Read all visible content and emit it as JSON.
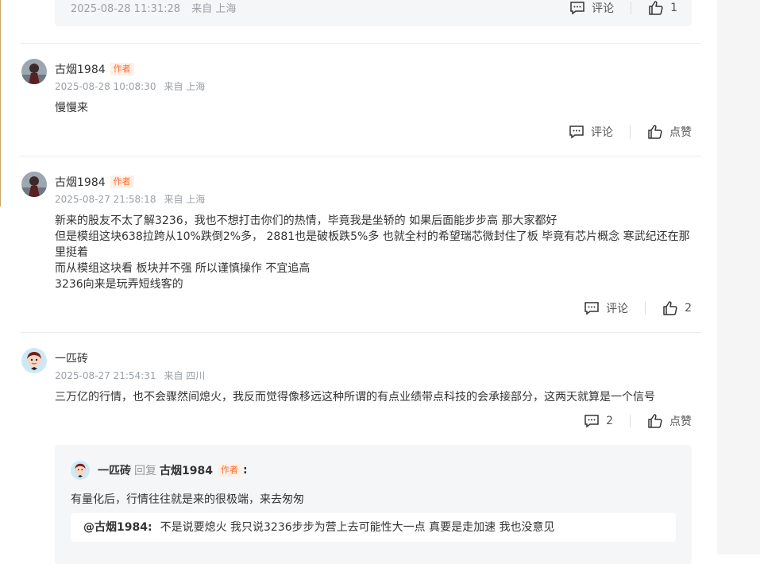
{
  "top_reply": {
    "datetime": "2025-08-28 11:31:28",
    "location": "来自 上海",
    "comment_label": "评论",
    "like_count": "1"
  },
  "comments": [
    {
      "author": "古烟1984",
      "badge": "作者",
      "datetime": "2025-08-28 10:08:30",
      "location": "来自 上海",
      "lines": [
        "慢慢来"
      ],
      "comment_label": "评论",
      "like_label": "点赞"
    },
    {
      "author": "古烟1984",
      "badge": "作者",
      "datetime": "2025-08-27 21:58:18",
      "location": "来自 上海",
      "lines": [
        "新来的股友不太了解3236，我也不想打击你们的热情，毕竟我是坐轿的 如果后面能步步高 那大家都好",
        "但是模组这块638拉跨从10%跌倒2%多， 2881也是破板跌5%多 也就全村的希望瑞芯微封住了板 毕竟有芯片概念 寒武纪还在那里挺着",
        "而从模组这块看 板块并不强 所以谨慎操作 不宜追高",
        "3236向来是玩弄短线客的"
      ],
      "comment_label": "评论",
      "like_count": "2"
    },
    {
      "author": "一匹砖",
      "datetime": "2025-08-27 21:54:31",
      "location": "来自 四川",
      "lines": [
        "三万亿的行情，也不会骤然间熄火，我反而觉得像移远这种所谓的有点业绩带点科技的会承接部分，这两天就算是一个信号"
      ],
      "comment_count": "2",
      "like_label": "点赞"
    }
  ],
  "reply": {
    "author": "一匹砖",
    "reply_word": "回复",
    "target": "古烟1984",
    "badge": "作者",
    "colon": ":",
    "text": "有量化后，行情往往就是来的很极端，来去匆匆",
    "quote_name": "@古烟1984:",
    "quote_text": "不是说要熄火 我只说3236步步为营上去可能性大一点 真要是走加速 我也没意见"
  }
}
